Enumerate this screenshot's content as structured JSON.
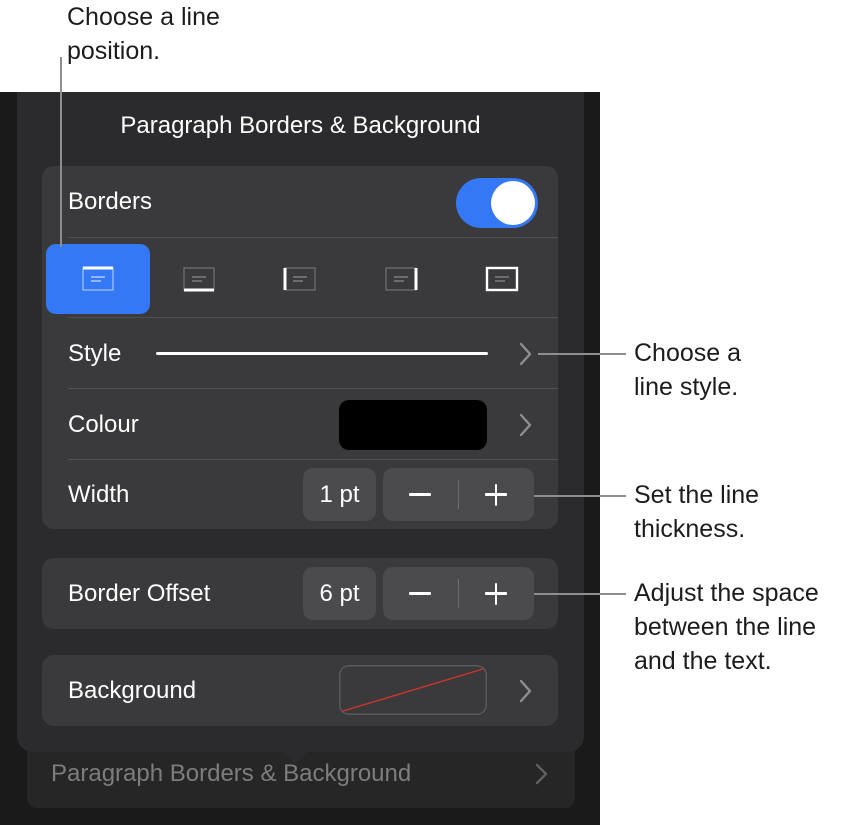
{
  "callouts": {
    "line_position": [
      "Choose a line",
      "position."
    ],
    "line_style": [
      "Choose a",
      "line style."
    ],
    "line_thickness": [
      "Set the line",
      "thickness."
    ],
    "space": [
      "Adjust the space",
      "between the line",
      "and the text."
    ]
  },
  "popover": {
    "title": "Paragraph Borders & Background",
    "borders": {
      "label": "Borders",
      "toggle_on": true,
      "positions": [
        "top",
        "bottom",
        "left",
        "right",
        "all"
      ],
      "selected_position": "top"
    },
    "style": {
      "label": "Style"
    },
    "colour": {
      "label": "Colour",
      "value": "#000000"
    },
    "width": {
      "label": "Width",
      "value": "1 pt",
      "minus": "−",
      "plus": "+"
    },
    "border_offset": {
      "label": "Border Offset",
      "value": "6 pt",
      "minus": "−",
      "plus": "+"
    },
    "background": {
      "label": "Background"
    }
  },
  "behind_row": {
    "label": "Paragraph Borders & Background"
  },
  "colors": {
    "accent": "#3478f6",
    "panel": "#2b2b2d",
    "group": "#3a3a3c"
  }
}
